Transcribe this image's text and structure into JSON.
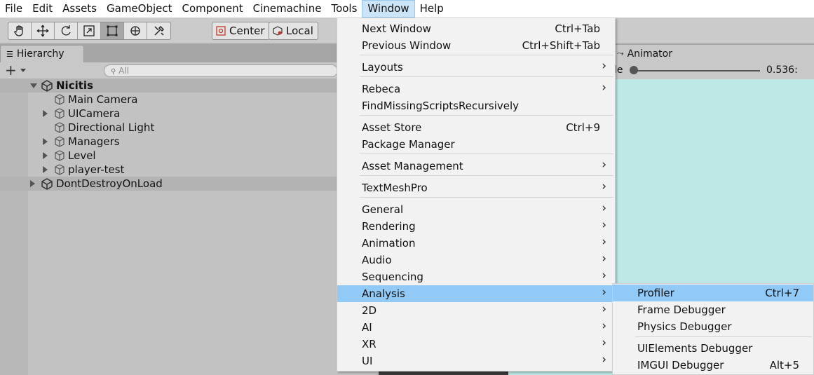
{
  "menubar": [
    "File",
    "Edit",
    "Assets",
    "GameObject",
    "Component",
    "Cinemachine",
    "Tools",
    "Window",
    "Help"
  ],
  "menubar_open_index": 7,
  "toolbar": {
    "pivot_center": "Center",
    "pivot_local": "Local",
    "tools": [
      "hand-icon",
      "move-icon",
      "rotate-icon",
      "scale-icon",
      "rect-tool-icon",
      "transform-icon",
      "custom-tool-icon"
    ]
  },
  "hierarchy": {
    "tab_label": "Hierarchy",
    "search_placeholder": "All",
    "rows": [
      {
        "label": "Nicitis",
        "type": "scene",
        "expanded": true
      },
      {
        "label": "Main Camera",
        "type": "object",
        "has_children": false
      },
      {
        "label": "UICamera",
        "type": "object",
        "has_children": true
      },
      {
        "label": "Directional Light",
        "type": "object",
        "has_children": false
      },
      {
        "label": "Managers",
        "type": "object",
        "has_children": true
      },
      {
        "label": "Level",
        "type": "object",
        "has_children": true
      },
      {
        "label": "player-test",
        "type": "object",
        "has_children": true
      },
      {
        "label": "DontDestroyOnLoad",
        "type": "scene",
        "expanded": false
      }
    ]
  },
  "animator": {
    "tab_label": "Animator",
    "scale_label": "le",
    "scale_value": "0.536:",
    "scale_fraction": 0.0
  },
  "window_menu": {
    "items": [
      {
        "label": "Next Window",
        "shortcut": "Ctrl+Tab",
        "submenu": false
      },
      {
        "label": "Previous Window",
        "shortcut": "Ctrl+Shift+Tab",
        "submenu": false
      },
      {
        "label": "Layouts",
        "shortcut": "",
        "submenu": true
      },
      {
        "label": "Rebeca",
        "shortcut": "",
        "submenu": true
      },
      {
        "label": "FindMissingScriptsRecursively",
        "shortcut": "",
        "submenu": false
      },
      {
        "label": "Asset Store",
        "shortcut": "Ctrl+9",
        "submenu": false
      },
      {
        "label": "Package Manager",
        "shortcut": "",
        "submenu": false
      },
      {
        "label": "Asset Management",
        "shortcut": "",
        "submenu": true
      },
      {
        "label": "TextMeshPro",
        "shortcut": "",
        "submenu": true
      },
      {
        "label": "General",
        "shortcut": "",
        "submenu": true
      },
      {
        "label": "Rendering",
        "shortcut": "",
        "submenu": true
      },
      {
        "label": "Animation",
        "shortcut": "",
        "submenu": true
      },
      {
        "label": "Audio",
        "shortcut": "",
        "submenu": true
      },
      {
        "label": "Sequencing",
        "shortcut": "",
        "submenu": true
      },
      {
        "label": "Analysis",
        "shortcut": "",
        "submenu": true,
        "highlighted": true
      },
      {
        "label": "2D",
        "shortcut": "",
        "submenu": true
      },
      {
        "label": "AI",
        "shortcut": "",
        "submenu": true
      },
      {
        "label": "XR",
        "shortcut": "",
        "submenu": true
      },
      {
        "label": "UI",
        "shortcut": "",
        "submenu": true
      }
    ]
  },
  "analysis_submenu": {
    "items": [
      {
        "label": "Profiler",
        "shortcut": "Ctrl+7",
        "highlighted": true
      },
      {
        "label": "Frame Debugger",
        "shortcut": ""
      },
      {
        "label": "Physics Debugger",
        "shortcut": ""
      },
      {
        "label": "UIElements Debugger",
        "shortcut": ""
      },
      {
        "label": "IMGUI Debugger",
        "shortcut": "Alt+5"
      }
    ]
  },
  "colors": {
    "highlight": "#91c9f7",
    "menu_bg": "#f2f2f2",
    "game_view": "#bde8e6"
  }
}
